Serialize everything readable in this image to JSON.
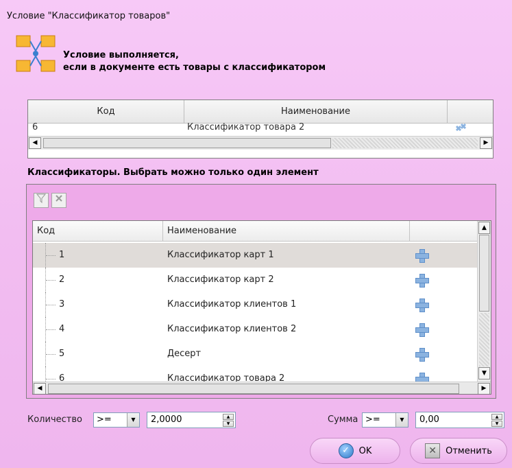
{
  "window": {
    "title": "Условие \"Классификатор товаров\""
  },
  "header": {
    "icon": "classifier-icon",
    "line1": "Условие выполняется,",
    "line2": "если в документе есть товары с классификатором"
  },
  "selected_grid": {
    "columns": [
      "Код",
      "Наименование",
      ""
    ],
    "rows": [
      {
        "code": "6",
        "name": "Классификатор товара 2"
      }
    ]
  },
  "classifiers": {
    "label": "Классификаторы. Выбрать можно только один элемент",
    "toolbar": {
      "filter_icon": "filter-icon",
      "clear_icon": "clear-filter-icon"
    },
    "columns": [
      "Код",
      "Наименование",
      ""
    ],
    "rows": [
      {
        "code": "1",
        "name": "Классификатор карт 1"
      },
      {
        "code": "2",
        "name": "Классификатор карт 2"
      },
      {
        "code": "3",
        "name": "Классификатор клиентов 1"
      },
      {
        "code": "4",
        "name": "Классификатор клиентов 2"
      },
      {
        "code": "5",
        "name": "Десерт"
      },
      {
        "code": "6",
        "name": "Классификатор товара 2"
      }
    ],
    "selected_index": 0
  },
  "quantity": {
    "label": "Количество",
    "operator": ">=",
    "value": "2,0000"
  },
  "sum": {
    "label": "Сумма",
    "operator": ">=",
    "value": "0,00"
  },
  "buttons": {
    "ok": "OK",
    "cancel": "Отменить"
  },
  "colors": {
    "background": "#f2bdf1",
    "accent": "#2f79c8"
  }
}
